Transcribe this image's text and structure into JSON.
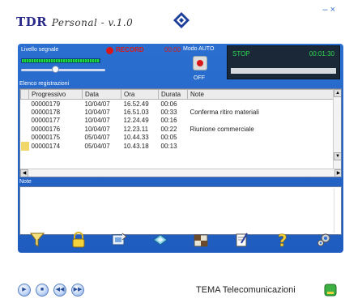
{
  "header": {
    "title": "TDR",
    "subtitle": "Personal - v.1.0",
    "close_glyph": "– ×"
  },
  "panel": {
    "signal_label": "Livello segnale",
    "record_label": "RECORD",
    "record_time": "00:00",
    "mode_label": "Modo AUTO",
    "mode_value": "OFF",
    "status_label": "STOP",
    "status_time": "00:01:30",
    "signal_level": 1.0,
    "slider_level": 0.4
  },
  "records": {
    "title": "Elenco registrazioni",
    "columns": [
      "Progressivo",
      "Data",
      "Ora",
      "Durata",
      "Note"
    ],
    "rows": [
      {
        "prog": "00000179",
        "data": "10/04/07",
        "ora": "16.52.49",
        "durata": "00:06",
        "note": ""
      },
      {
        "prog": "00000178",
        "data": "10/04/07",
        "ora": "16.51.03",
        "durata": "00:33",
        "note": "Conferma ritiro materiali"
      },
      {
        "prog": "00000177",
        "data": "10/04/07",
        "ora": "12.24.49",
        "durata": "00:16",
        "note": ""
      },
      {
        "prog": "00000176",
        "data": "10/04/07",
        "ora": "12.23.11",
        "durata": "00:22",
        "note": "Riunione commerciale"
      },
      {
        "prog": "00000175",
        "data": "05/04/07",
        "ora": "10.44.33",
        "durata": "00:05",
        "note": ""
      },
      {
        "prog": "00000174",
        "data": "05/04/07",
        "ora": "10.43.18",
        "durata": "00:13",
        "note": ""
      }
    ]
  },
  "notes": {
    "title": "Note"
  },
  "toolbar": {
    "items": [
      {
        "label": "Filtra",
        "icon": "funnel-icon"
      },
      {
        "label": "Proteggi",
        "icon": "lock-icon"
      },
      {
        "label": "Invia",
        "icon": "send-icon"
      },
      {
        "label": "Esporta",
        "icon": "disk-icon"
      },
      {
        "label": "Archivio",
        "icon": "archive-icon"
      },
      {
        "label": "Note",
        "icon": "notepad-icon"
      },
      {
        "label": "Guida",
        "icon": "help-icon"
      },
      {
        "label": "Opzioni",
        "icon": "gear-icon"
      }
    ]
  },
  "footer": {
    "company": "TEMA Telecomunicazioni",
    "controls": [
      "play",
      "stop",
      "rewind",
      "fast-forward"
    ]
  },
  "colors": {
    "panel_blue": "#2a6fd0",
    "led_green": "#1fd84a",
    "record_red": "#d81818"
  }
}
